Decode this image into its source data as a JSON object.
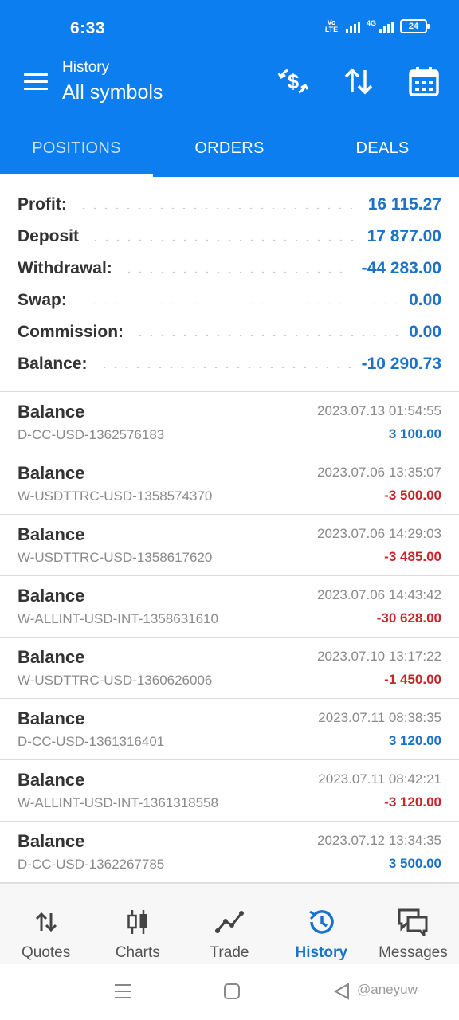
{
  "status_bar": {
    "time": "6:33",
    "volte": "Vo LTE",
    "network": "4G",
    "battery": "24"
  },
  "app_bar": {
    "subtitle": "History",
    "title": "All symbols",
    "icons": [
      "menu-icon",
      "dollar-exchange-icon",
      "sort-icon",
      "calendar-icon"
    ]
  },
  "tabs": [
    {
      "label": "POSITIONS",
      "active": true
    },
    {
      "label": "ORDERS",
      "active": false
    },
    {
      "label": "DEALS",
      "active": false
    }
  ],
  "summary": {
    "profit": {
      "label": "Profit:",
      "value": "16 115.27"
    },
    "deposit": {
      "label": "Deposit",
      "value": "17 877.00"
    },
    "withdrawal": {
      "label": "Withdrawal:",
      "value": "-44 283.00"
    },
    "swap": {
      "label": "Swap:",
      "value": "0.00"
    },
    "commission": {
      "label": "Commission:",
      "value": "0.00"
    },
    "balance": {
      "label": "Balance:",
      "value": "-10 290.73"
    }
  },
  "deals": [
    {
      "type": "Balance",
      "comment": "D-CC-USD-1362576183",
      "datetime": "2023.07.13 01:54:55",
      "amount": "3 100.00"
    },
    {
      "type": "Balance",
      "comment": "W-USDTTRC-USD-1358574370",
      "datetime": "2023.07.06 13:35:07",
      "amount": "-3 500.00"
    },
    {
      "type": "Balance",
      "comment": "W-USDTTRC-USD-1358617620",
      "datetime": "2023.07.06 14:29:03",
      "amount": "-3 485.00"
    },
    {
      "type": "Balance",
      "comment": "W-ALLINT-USD-INT-1358631610",
      "datetime": "2023.07.06 14:43:42",
      "amount": "-30 628.00"
    },
    {
      "type": "Balance",
      "comment": "W-USDTTRC-USD-1360626006",
      "datetime": "2023.07.10 13:17:22",
      "amount": "-1 450.00"
    },
    {
      "type": "Balance",
      "comment": "D-CC-USD-1361316401",
      "datetime": "2023.07.11 08:38:35",
      "amount": "3 120.00"
    },
    {
      "type": "Balance",
      "comment": "W-ALLINT-USD-INT-1361318558",
      "datetime": "2023.07.11 08:42:21",
      "amount": "-3 120.00"
    },
    {
      "type": "Balance",
      "comment": "D-CC-USD-1362267785",
      "datetime": "2023.07.12 13:34:35",
      "amount": "3 500.00"
    }
  ],
  "bottom_nav": [
    {
      "label": "Quotes",
      "icon": "quotes-icon",
      "active": false
    },
    {
      "label": "Charts",
      "icon": "charts-icon",
      "active": false
    },
    {
      "label": "Trade",
      "icon": "trade-icon",
      "active": false
    },
    {
      "label": "History",
      "icon": "history-icon",
      "active": true
    },
    {
      "label": "Messages",
      "icon": "messages-icon",
      "active": false
    }
  ],
  "watermark": "@aneyuw",
  "colors": {
    "primary": "#0c7ef0",
    "positive": "#1a73c9",
    "negative": "#c8262b"
  }
}
